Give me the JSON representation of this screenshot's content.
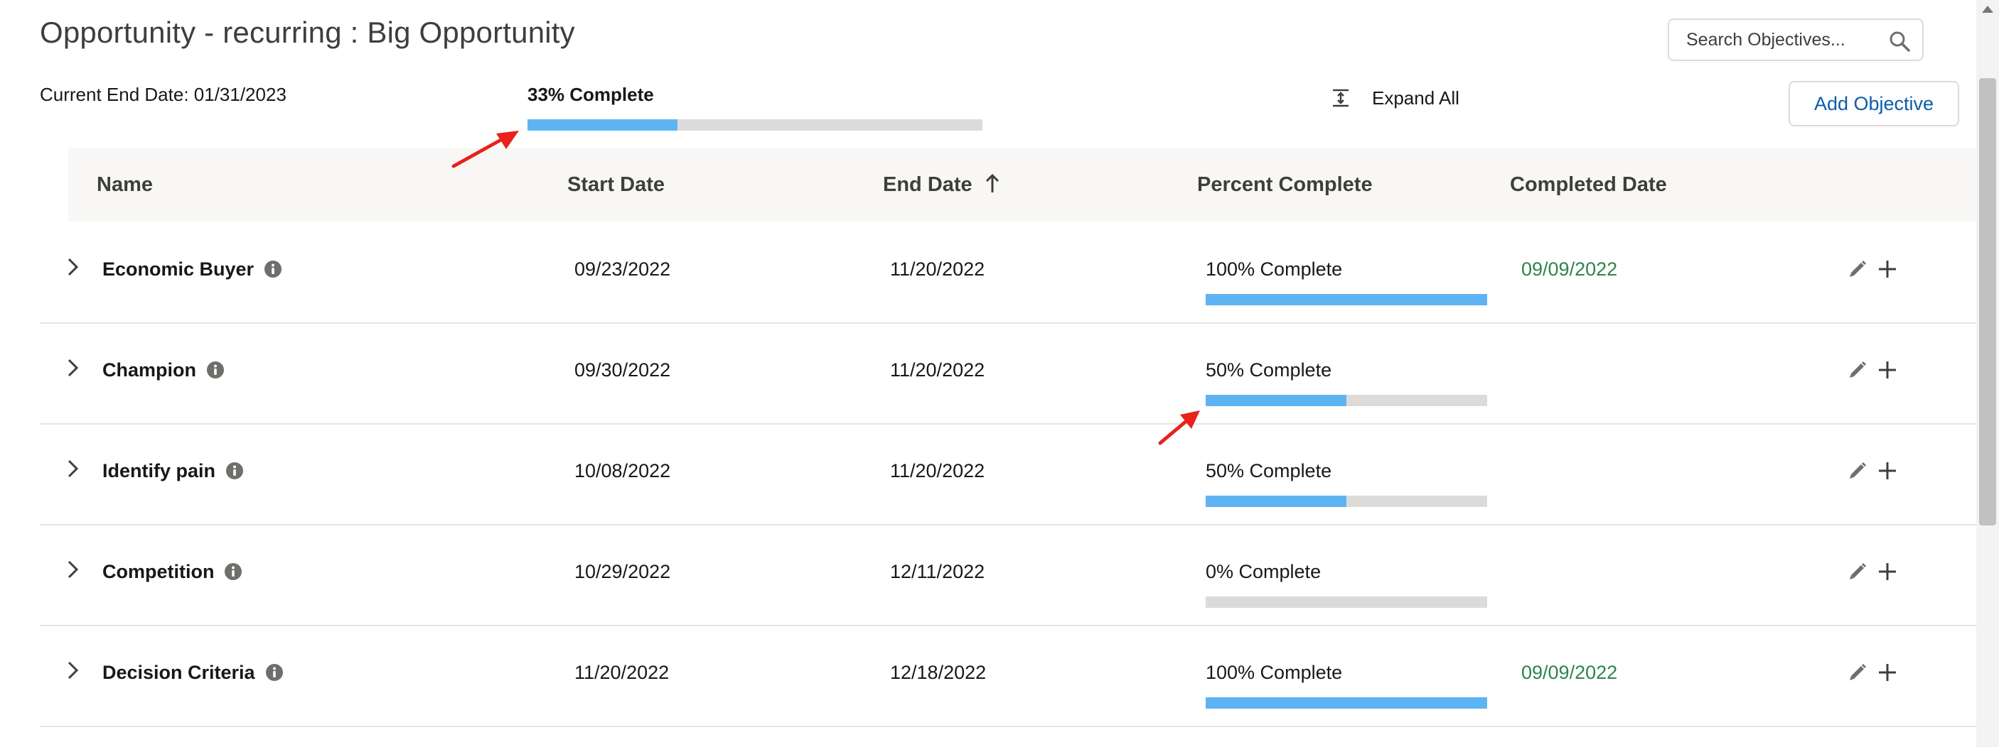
{
  "header": {
    "title": "Opportunity - recurring : Big Opportunity",
    "end_date_text": "Current End Date: 01/31/2023",
    "overall_progress_label": "33% Complete",
    "overall_progress_fraction": 0.33
  },
  "search": {
    "placeholder": "Search Objectives..."
  },
  "toolbar": {
    "expand_all_label": "Expand All",
    "add_objective_label": "Add Objective"
  },
  "table": {
    "columns": {
      "name": "Name",
      "start_date": "Start Date",
      "end_date": "End Date",
      "percent_complete": "Percent Complete",
      "completed_date": "Completed Date"
    },
    "sort": {
      "column": "End Date",
      "direction": "ascending"
    },
    "rows": [
      {
        "name": "Economic Buyer",
        "start_date": "09/23/2022",
        "end_date": "11/20/2022",
        "percent_label": "100% Complete",
        "percent_fraction": 1.0,
        "completed_date": "09/09/2022"
      },
      {
        "name": "Champion",
        "start_date": "09/30/2022",
        "end_date": "11/20/2022",
        "percent_label": "50% Complete",
        "percent_fraction": 0.5,
        "completed_date": ""
      },
      {
        "name": "Identify pain",
        "start_date": "10/08/2022",
        "end_date": "11/20/2022",
        "percent_label": "50% Complete",
        "percent_fraction": 0.5,
        "completed_date": ""
      },
      {
        "name": "Competition",
        "start_date": "10/29/2022",
        "end_date": "12/11/2022",
        "percent_label": "0% Complete",
        "percent_fraction": 0.0,
        "completed_date": ""
      },
      {
        "name": "Decision Criteria",
        "start_date": "11/20/2022",
        "end_date": "12/18/2022",
        "percent_label": "100% Complete",
        "percent_fraction": 1.0,
        "completed_date": "09/09/2022"
      }
    ]
  },
  "colors": {
    "progress_fill": "#5eb4f3",
    "progress_track": "#dddbda",
    "completed_date": "#2e844a",
    "link_blue": "#0b5cab",
    "annotation_arrow": "#e8221b"
  },
  "icons": {
    "search": "search-icon",
    "expand": "expand-all-icon",
    "sort": "sort-ascending-arrow-icon",
    "chevron": "chevron-right-icon",
    "info": "info-icon",
    "edit": "pencil-icon",
    "add": "plus-icon"
  }
}
